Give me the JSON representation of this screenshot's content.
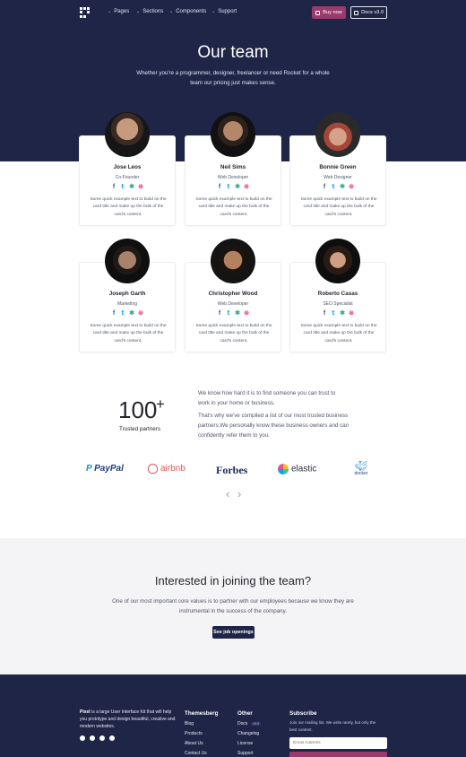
{
  "nav": {
    "items": [
      "Pages",
      "Sections",
      "Components",
      "Support"
    ],
    "buy_label": "Buy now",
    "docs_label": "Docs v3.0"
  },
  "hero": {
    "title": "Our team",
    "subtitle_line1": "Whether you're a programmer, designer, freelancer or need Rocket for a whole",
    "subtitle_line2": "team our pricing just makes sense."
  },
  "team": [
    {
      "name": "Jose Leos",
      "role": "Co-Founder"
    },
    {
      "name": "Neil Sims",
      "role": "Web Developer"
    },
    {
      "name": "Bonnie Green",
      "role": "Web Designer"
    },
    {
      "name": "Joseph Garth",
      "role": "Marketing"
    },
    {
      "name": "Christopher Wood",
      "role": "Web Developer"
    },
    {
      "name": "Roberto Casas",
      "role": "SEO Specialist"
    }
  ],
  "card_text": [
    "Some quick example text to build on the",
    "card title and make up the bulk of the",
    "card's content."
  ],
  "social_icons": [
    "facebook-icon",
    "twitter-icon",
    "slack-icon",
    "dribbble-icon"
  ],
  "social_colors": {
    "facebook": "#3b5998",
    "twitter": "#1da1f2",
    "slack": "#3aaf85",
    "dribbble": "#ea4c89"
  },
  "stats": {
    "number": "100",
    "sup": "+",
    "label": "Trusted partners",
    "para1": [
      "We know how hard it is to find someone you can trust to",
      "work in your home or business."
    ],
    "para2": [
      "That's why we've compiled a list of our most trusted business",
      "partners.We personally know these business owners and can",
      "confidently refer them to you."
    ]
  },
  "partners": [
    {
      "name": "PayPal",
      "color": "#1d3c7f"
    },
    {
      "name": "airbnb",
      "color": "#e2555b"
    },
    {
      "name": "Forbes",
      "color": "#1c2a5c"
    },
    {
      "name": "elastic",
      "color": "#2b2f3a"
    },
    {
      "name": "docker",
      "color": "#1d8fd6"
    }
  ],
  "carousel": {
    "prev": "‹",
    "next": "›"
  },
  "join": {
    "title": "Interested in joining the team?",
    "text_line1": "One of our most important core values is to partner with our employees because we know they are",
    "text_line2": "instrumental in the success of the company.",
    "button": "See job openings"
  },
  "footer": {
    "brand": "Pixel",
    "about_line1": " is a large User Interface Kit that will help",
    "about_line2": "you prototype and design beautiful, creative and",
    "about_line3": "modern websites.",
    "col1_title": "Themesberg",
    "col1_links": [
      "Blog",
      "Products",
      "About Us",
      "Contact Us"
    ],
    "col2_title": "Other",
    "col2_links": [
      "Docs",
      "Changelog",
      "License",
      "Support"
    ],
    "docs_badge": "v3.0",
    "subscribe_title": "Subscribe",
    "subscribe_text_line1": "Join our mailing list. We write rarely, but only the",
    "subscribe_text_line2": "best content.",
    "email_placeholder": "Email Address"
  }
}
